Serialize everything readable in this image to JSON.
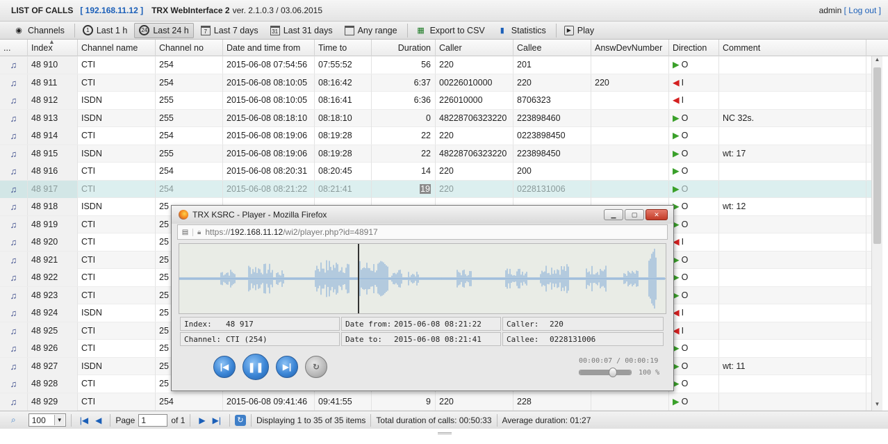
{
  "header": {
    "title": "LIST OF CALLS",
    "ip": "192.168.11.12",
    "app_name": "TRX WebInterface 2",
    "version": "ver. 2.1.0.3 / 03.06.2015",
    "user": "admin",
    "logout": "Log out"
  },
  "toolbar": {
    "channels": "Channels",
    "last_1h": "Last 1 h",
    "last_24h": "Last 24 h",
    "last_7d": "Last 7 days",
    "last_31d": "Last 31 days",
    "any_range": "Any range",
    "export_csv": "Export to CSV",
    "statistics": "Statistics",
    "play": "Play",
    "cal7": "7",
    "cal31": "31",
    "clock1": "1",
    "clock24": "24"
  },
  "columns": {
    "menu": "...",
    "index": "Index",
    "channel_name": "Channel name",
    "channel_no": "Channel no",
    "date_from": "Date and time from",
    "time_to": "Time to",
    "duration": "Duration",
    "caller": "Caller",
    "callee": "Callee",
    "answ_dev": "AnswDevNumber",
    "direction": "Direction",
    "comment": "Comment"
  },
  "rows": [
    {
      "index": "48 910",
      "channel_name": "CTI",
      "channel_no": "254",
      "date_from": "2015-06-08 07:54:56",
      "time_to": "07:55:52",
      "duration": "56",
      "caller": "220",
      "callee": "201",
      "answ_dev": "",
      "direction": "O",
      "dir": "out",
      "comment": ""
    },
    {
      "index": "48 911",
      "channel_name": "CTI",
      "channel_no": "254",
      "date_from": "2015-06-08 08:10:05",
      "time_to": "08:16:42",
      "duration": "6:37",
      "caller": "00226010000",
      "callee": "220",
      "answ_dev": "220",
      "direction": "I",
      "dir": "in",
      "comment": ""
    },
    {
      "index": "48 912",
      "channel_name": "ISDN",
      "channel_no": "255",
      "date_from": "2015-06-08 08:10:05",
      "time_to": "08:16:41",
      "duration": "6:36",
      "caller": "226010000",
      "callee": "8706323",
      "answ_dev": "",
      "direction": "I",
      "dir": "in",
      "comment": ""
    },
    {
      "index": "48 913",
      "channel_name": "ISDN",
      "channel_no": "255",
      "date_from": "2015-06-08 08:18:10",
      "time_to": "08:18:10",
      "duration": "0",
      "caller": "48228706323220",
      "callee": "223898460",
      "answ_dev": "",
      "direction": "O",
      "dir": "out",
      "comment": "NC 32s."
    },
    {
      "index": "48 914",
      "channel_name": "CTI",
      "channel_no": "254",
      "date_from": "2015-06-08 08:19:06",
      "time_to": "08:19:28",
      "duration": "22",
      "caller": "220",
      "callee": "0223898450",
      "answ_dev": "",
      "direction": "O",
      "dir": "out",
      "comment": ""
    },
    {
      "index": "48 915",
      "channel_name": "ISDN",
      "channel_no": "255",
      "date_from": "2015-06-08 08:19:06",
      "time_to": "08:19:28",
      "duration": "22",
      "caller": "48228706323220",
      "callee": "223898450",
      "answ_dev": "",
      "direction": "O",
      "dir": "out",
      "comment": "wt: 17"
    },
    {
      "index": "48 916",
      "channel_name": "CTI",
      "channel_no": "254",
      "date_from": "2015-06-08 08:20:31",
      "time_to": "08:20:45",
      "duration": "14",
      "caller": "220",
      "callee": "200",
      "answ_dev": "",
      "direction": "O",
      "dir": "out",
      "comment": ""
    },
    {
      "index": "48 917",
      "channel_name": "CTI",
      "channel_no": "254",
      "date_from": "2015-06-08 08:21:22",
      "time_to": "08:21:41",
      "duration": "19",
      "caller": "220",
      "callee": "0228131006",
      "answ_dev": "",
      "direction": "O",
      "dir": "out",
      "comment": ""
    },
    {
      "index": "48 918",
      "channel_name": "ISDN",
      "channel_no": "25",
      "date_from": "",
      "time_to": "",
      "duration": "",
      "caller": "",
      "callee": "",
      "answ_dev": "",
      "direction": "O",
      "dir": "out",
      "comment": "wt: 12"
    },
    {
      "index": "48 919",
      "channel_name": "CTI",
      "channel_no": "25",
      "date_from": "",
      "time_to": "",
      "duration": "",
      "caller": "",
      "callee": "",
      "answ_dev": "",
      "direction": "O",
      "dir": "out",
      "comment": ""
    },
    {
      "index": "48 920",
      "channel_name": "CTI",
      "channel_no": "25",
      "date_from": "",
      "time_to": "",
      "duration": "",
      "caller": "",
      "callee": "",
      "answ_dev": "",
      "direction": "I",
      "dir": "in",
      "comment": ""
    },
    {
      "index": "48 921",
      "channel_name": "CTI",
      "channel_no": "25",
      "date_from": "",
      "time_to": "",
      "duration": "",
      "caller": "",
      "callee": "",
      "answ_dev": "",
      "direction": "O",
      "dir": "out",
      "comment": ""
    },
    {
      "index": "48 922",
      "channel_name": "CTI",
      "channel_no": "25",
      "date_from": "",
      "time_to": "",
      "duration": "",
      "caller": "",
      "callee": "",
      "answ_dev": "",
      "direction": "O",
      "dir": "out",
      "comment": ""
    },
    {
      "index": "48 923",
      "channel_name": "CTI",
      "channel_no": "25",
      "date_from": "",
      "time_to": "",
      "duration": "",
      "caller": "",
      "callee": "",
      "answ_dev": "",
      "direction": "O",
      "dir": "out",
      "comment": ""
    },
    {
      "index": "48 924",
      "channel_name": "ISDN",
      "channel_no": "25",
      "date_from": "",
      "time_to": "",
      "duration": "",
      "caller": "",
      "callee": "",
      "answ_dev": "",
      "direction": "I",
      "dir": "in",
      "comment": ""
    },
    {
      "index": "48 925",
      "channel_name": "CTI",
      "channel_no": "25",
      "date_from": "",
      "time_to": "",
      "duration": "",
      "caller": "",
      "callee": "",
      "answ_dev": "",
      "direction": "I",
      "dir": "in",
      "comment": ""
    },
    {
      "index": "48 926",
      "channel_name": "CTI",
      "channel_no": "25",
      "date_from": "",
      "time_to": "",
      "duration": "",
      "caller": "",
      "callee": "",
      "answ_dev": "",
      "direction": "O",
      "dir": "out",
      "comment": ""
    },
    {
      "index": "48 927",
      "channel_name": "ISDN",
      "channel_no": "25",
      "date_from": "",
      "time_to": "",
      "duration": "",
      "caller": "",
      "callee": "",
      "answ_dev": "",
      "direction": "O",
      "dir": "out",
      "comment": "wt: 11"
    },
    {
      "index": "48 928",
      "channel_name": "CTI",
      "channel_no": "25",
      "date_from": "",
      "time_to": "",
      "duration": "",
      "caller": "",
      "callee": "",
      "answ_dev": "",
      "direction": "O",
      "dir": "out",
      "comment": ""
    },
    {
      "index": "48 929",
      "channel_name": "CTI",
      "channel_no": "254",
      "date_from": "2015-06-08 09:41:46",
      "time_to": "09:41:55",
      "duration": "9",
      "caller": "220",
      "callee": "228",
      "answ_dev": "",
      "direction": "O",
      "dir": "out",
      "comment": ""
    }
  ],
  "selected_row": 7,
  "footer": {
    "page_size": "100",
    "page_label": "Page",
    "page_value": "1",
    "of_label": "of 1",
    "displaying": "Displaying 1 to 35 of 35 items",
    "total_duration": "Total duration of calls: 00:50:33",
    "avg_duration": "Average duration: 01:27"
  },
  "player": {
    "window_title": "TRX KSRC - Player - Mozilla Firefox",
    "url_prefix": "https://",
    "url_host": "192.168.11.12",
    "url_path": "/wi2/player.php?id=48917",
    "info": {
      "index_label": "Index:",
      "index_value": "48 917",
      "datefrom_label": "Date from:",
      "datefrom_value": "2015-06-08 08:21:22",
      "caller_label": "Caller:",
      "caller_value": "220",
      "channel_label": "Channel:",
      "channel_value": "CTI (254)",
      "dateto_label": "Date to:",
      "dateto_value": "2015-06-08 08:21:41",
      "callee_label": "Callee:",
      "callee_value": "0228131006"
    },
    "time": "00:00:07 / 00:00:19",
    "progress_fraction": 0.368,
    "volume_percent": 100,
    "volume_label": "100 %",
    "colors": {
      "wave": "#8fb3d9",
      "playhead": "#333333"
    }
  }
}
